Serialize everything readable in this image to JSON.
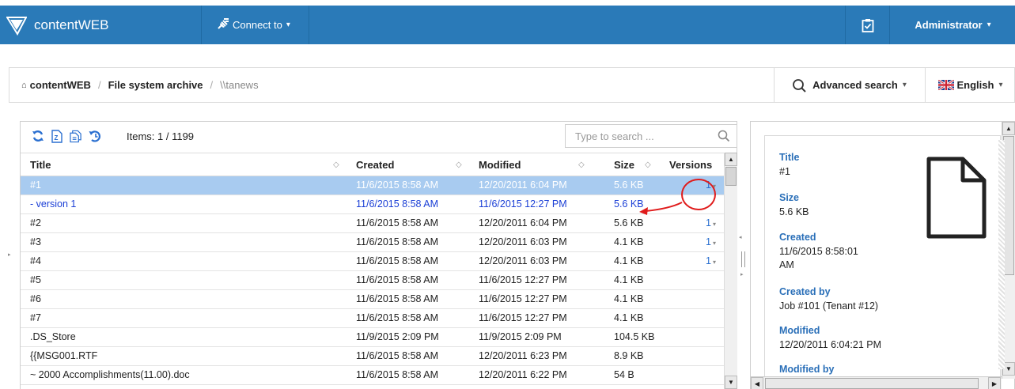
{
  "app": {
    "name": "contentWEB",
    "connect_label": "Connect to",
    "user_label": "Administrator"
  },
  "breadcrumb": {
    "home": "contentWEB",
    "section": "File system archive",
    "current": "\\\\tanews"
  },
  "header_actions": {
    "advanced_search": "Advanced search",
    "language": "English"
  },
  "toolbar": {
    "items_label": "Items: 1 / 1199",
    "search_placeholder": "Type to search ..."
  },
  "grid": {
    "columns": [
      "Title",
      "Created",
      "Modified",
      "Size",
      "Versions"
    ],
    "rows": [
      {
        "title": "#1",
        "created": "11/6/2015 8:58 AM",
        "modified": "12/20/2011 6:04 PM",
        "size": "5.6 KB",
        "versions": "1"
      },
      {
        "title": "- version 1",
        "created": "11/6/2015 8:58 AM",
        "modified": "11/6/2015 12:27 PM",
        "size": "5.6 KB",
        "versions": ""
      },
      {
        "title": "#2",
        "created": "11/6/2015 8:58 AM",
        "modified": "12/20/2011 6:04 PM",
        "size": "5.6 KB",
        "versions": "1"
      },
      {
        "title": "#3",
        "created": "11/6/2015 8:58 AM",
        "modified": "12/20/2011 6:03 PM",
        "size": "4.1 KB",
        "versions": "1"
      },
      {
        "title": "#4",
        "created": "11/6/2015 8:58 AM",
        "modified": "12/20/2011 6:03 PM",
        "size": "4.1 KB",
        "versions": "1"
      },
      {
        "title": "#5",
        "created": "11/6/2015 8:58 AM",
        "modified": "11/6/2015 12:27 PM",
        "size": "4.1 KB",
        "versions": ""
      },
      {
        "title": "#6",
        "created": "11/6/2015 8:58 AM",
        "modified": "11/6/2015 12:27 PM",
        "size": "4.1 KB",
        "versions": ""
      },
      {
        "title": "#7",
        "created": "11/6/2015 8:58 AM",
        "modified": "11/6/2015 12:27 PM",
        "size": "4.1 KB",
        "versions": ""
      },
      {
        "title": ".DS_Store",
        "created": "11/9/2015 2:09 PM",
        "modified": "11/9/2015 2:09 PM",
        "size": "104.5 KB",
        "versions": ""
      },
      {
        "title": "{{MSG001.RTF",
        "created": "11/6/2015 8:58 AM",
        "modified": "12/20/2011 6:23 PM",
        "size": "8.9 KB",
        "versions": ""
      },
      {
        "title": "~ 2000 Accomplishments(11.00).doc",
        "created": "11/6/2015 8:58 AM",
        "modified": "12/20/2011 6:22 PM",
        "size": "54 B",
        "versions": ""
      }
    ]
  },
  "details": {
    "fields": [
      {
        "label": "Title",
        "value": "#1"
      },
      {
        "label": "Size",
        "value": "5.6 KB"
      },
      {
        "label": "Created",
        "value": "11/6/2015 8:58:01 AM"
      },
      {
        "label": "Created by",
        "value": "Job #101 (Tenant #12)"
      },
      {
        "label": "Modified",
        "value": "12/20/2011 6:04:21 PM"
      },
      {
        "label": "Modified by",
        "value": ""
      }
    ]
  },
  "colors": {
    "navbar": "#2a7ab8",
    "selected_row": "#a8cbf0",
    "version_text": "#1b3fd6",
    "annotation_red": "#e01b1b",
    "detail_label": "#2a6fb8"
  }
}
